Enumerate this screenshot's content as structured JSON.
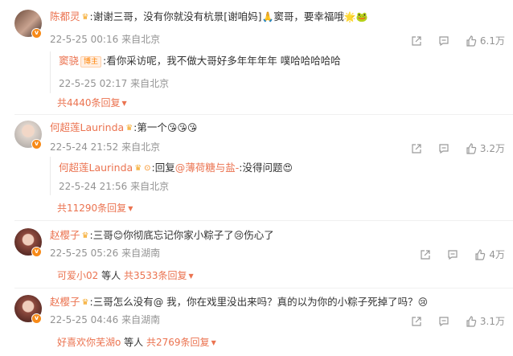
{
  "comments": [
    {
      "name": "陈都灵",
      "text": ":谢谢三哥，没有你就没有杭景[谢咱妈]",
      "emoji1": "🙏",
      "text2": "窦哥，要幸福哦",
      "emoji2": "🌟🐸",
      "date": "22-5-25 00:16",
      "location": "来自北京",
      "likes": "6.1万",
      "reply": {
        "name": "窦骁",
        "tag": "博主",
        "text": ":看你采访呢，我不做大哥好多年年年年 噗哈哈哈哈哈",
        "date": "22-5-25 02:17",
        "location": "来自北京"
      },
      "more": "共4440条回复"
    },
    {
      "name": "何超莲Laurinda",
      "text": ":第一个",
      "emoji1": "😘😘😘",
      "date": "22-5-24 21:52",
      "location": "来自北京",
      "likes": "3.2万",
      "reply": {
        "name": "何超莲Laurinda",
        "text": ":回复",
        "mention": "@薄荷糖与盐-",
        "text2": ":没得问题",
        "emoji": "😍",
        "date": "22-5-24 21:56",
        "location": "来自北京"
      },
      "more": "共11290条回复"
    },
    {
      "name": "赵樱子",
      "text": ":三哥",
      "emoji1": "😊",
      "text2": "你彻底忘记你家小粽子了",
      "emoji2": "😢",
      "text3": "伤心了",
      "date": "22-5-25 05:26",
      "location": "来自湖南",
      "likes": "4万",
      "more_prefix": "可爱小02",
      "more_mid": "等人",
      "more": "共3533条回复"
    },
    {
      "name": "赵樱子",
      "text": ":三哥怎么没有@ 我，你在戏里没出来吗？真的以为你的小粽子死掉了吗？",
      "emoji1": "😢",
      "date": "22-5-25 04:46",
      "location": "来自湖南",
      "likes": "3.1万",
      "more_prefix": "好喜欢你芜湖o",
      "more_mid": "等人",
      "more": "共2769条回复"
    }
  ],
  "icons": {
    "share": "share-icon",
    "comment": "comment-icon",
    "like": "thumbs-up-icon",
    "verified": "verified-badge-icon",
    "member": "crown-icon"
  },
  "colors": {
    "name": "#eb7350",
    "meta": "#939393",
    "accent": "#ff8200"
  }
}
